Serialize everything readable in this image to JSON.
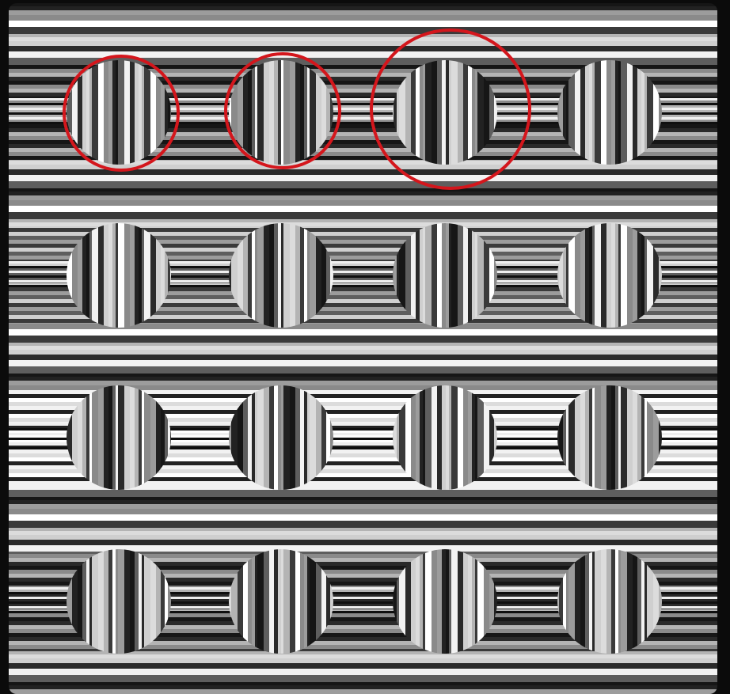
{
  "image": {
    "subject": "circles-optical-illusion",
    "palette": {
      "background": "#0b0b0b",
      "stripe_dark": "#161616",
      "stripe_mid": "#7a7a7a",
      "stripe_light": "#f2f2f2",
      "highlight_circle": "#d4161c"
    },
    "grid": {
      "rows": 4,
      "columns_per_row": 4
    },
    "highlighted_circles": 3
  }
}
